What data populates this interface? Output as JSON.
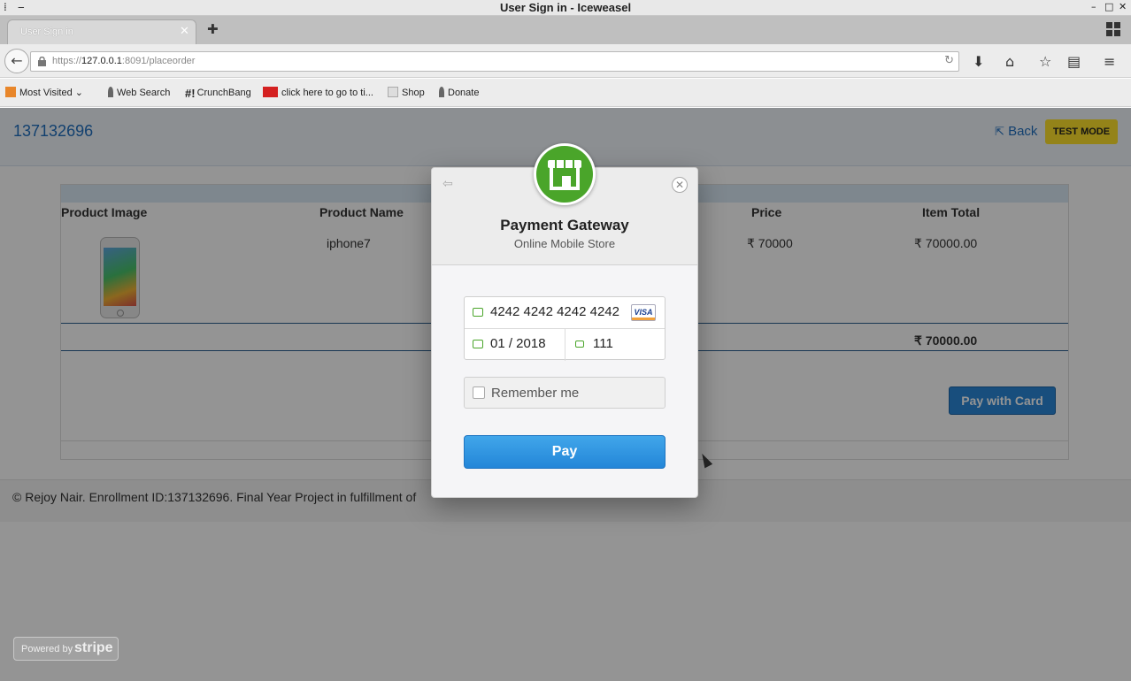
{
  "window": {
    "title": "User Sign in - Iceweasel"
  },
  "tabs": [
    {
      "label": "User Sign in"
    }
  ],
  "urlbar": {
    "prefix": "https://",
    "host": "127.0.0.1",
    "rest": ":8091/placeorder"
  },
  "bookmarks": [
    {
      "label": "Most Visited ⌄",
      "icon": "most-visited-icon"
    },
    {
      "label": "Web Search",
      "icon": "flame-icon"
    },
    {
      "label": "CrunchBang",
      "icon": "hash-icon"
    },
    {
      "label": "click here to go to ti...",
      "icon": "toi-icon"
    },
    {
      "label": "Shop",
      "icon": "page-icon"
    },
    {
      "label": "Donate",
      "icon": "flame-icon"
    }
  ],
  "page": {
    "brand": "137132696",
    "back_label": "Back",
    "test_mode": "TEST MODE",
    "table": {
      "headers": [
        "Product Image",
        "Product Name",
        "Price",
        "Item Total"
      ],
      "rows": [
        {
          "name": "iphone7",
          "price": "₹ 70000",
          "item_total": "₹ 70000.00"
        }
      ],
      "grand_total": "₹ 70000.00"
    },
    "pay_with_card": "Pay with Card",
    "footer": "© Rejoy Nair. Enrollment ID:137132696. Final Year Project in fulfillment of"
  },
  "modal": {
    "title": "Payment Gateway",
    "subtitle": "Online Mobile Store",
    "card_number": "4242 4242 4242 4242",
    "card_brand": "VISA",
    "expiry": "01 / 2018",
    "cvc": "111",
    "remember_label": "Remember me",
    "pay_label": "Pay"
  },
  "stripe_badge": {
    "powered_by": "Powered by",
    "brand": "stripe"
  },
  "colors": {
    "accent": "#1f6fbf",
    "pay_button": "#2a87d8",
    "test_mode": "#ffe22b",
    "logo_green": "#4aa52a"
  }
}
